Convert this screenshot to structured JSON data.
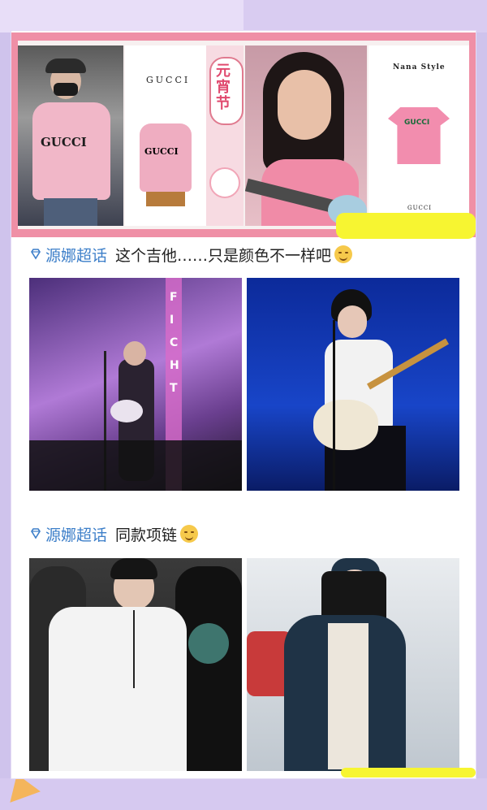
{
  "collage": {
    "brand_left": "GUCCI",
    "brand_right": "Nana Style",
    "brand_right_bottom": "GUCCI",
    "sweater_print": "GUCCI",
    "sweater_print_small": "GUCCI",
    "tee_print": "GUCCI",
    "festival_title": "元宵节"
  },
  "posts": [
    {
      "topic": "源娜超话",
      "text": "这个吉他……只是颜色不一样吧"
    },
    {
      "topic": "源娜超话",
      "text": "同款项链"
    }
  ],
  "stage_sign": "FICHT"
}
